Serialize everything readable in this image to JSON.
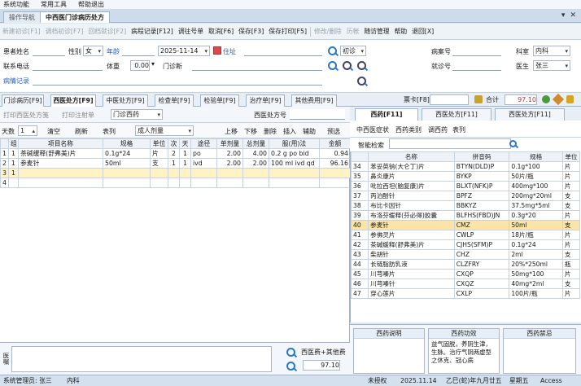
{
  "menu": [
    "系统功能",
    "常用工具",
    "帮助退出"
  ],
  "doc_tabs": [
    "操作导航",
    "中西医门诊病历处方"
  ],
  "window_controls": [
    "▾",
    "✕"
  ],
  "toolbar": [
    {
      "label": "新建初诊[F1]",
      "enabled": false
    },
    {
      "label": "调档初诊[F7]",
      "enabled": false
    },
    {
      "label": "回档就诊[F2]",
      "enabled": false
    },
    {
      "label": "病程记录[F12]",
      "enabled": true
    },
    {
      "label": "调往号单",
      "enabled": true
    },
    {
      "label": "取消[F6]",
      "enabled": true
    },
    {
      "label": "保存[F3]",
      "enabled": true
    },
    {
      "label": "保存打印[F5]",
      "enabled": true
    },
    {
      "label": "修改/删除",
      "enabled": false
    },
    {
      "label": "历帐",
      "enabled": false
    },
    {
      "label": "随访管理",
      "enabled": true
    },
    {
      "label": "帮助",
      "enabled": true
    },
    {
      "label": "退回[X]",
      "enabled": true
    }
  ],
  "form": {
    "name_label": "患者姓名",
    "gender_label": "性别",
    "gender_value": "女",
    "age_label": "年龄",
    "date_value": "2025-11-14",
    "address_label": "住址",
    "visit_type": "初诊",
    "case_no_label": "病案号",
    "dept_label": "科室",
    "dept_value": "内科",
    "phone_label": "联系电话",
    "weight_label": "体重",
    "weight_value": "0.00",
    "diagnosis_label": "门诊断",
    "visit_no_label": "就诊号",
    "doctor_label": "医生",
    "doctor_value": "张三",
    "record_label": "病情记录"
  },
  "left_tabs": [
    "门诊病历[F9]",
    "西医处方[F9]",
    "中医处方[F9]",
    "检查单[F9]",
    "检验单[F9]",
    "治疗单[F9]",
    "其他费用[F9]"
  ],
  "left_tabs_active": 1,
  "rx_bar": {
    "print_rx": "打印西医处方笺",
    "print_inj": "打印注射单",
    "rx_type": "门诊西药",
    "rx_no_label": "西医处方号"
  },
  "top_right": {
    "ticket_label": "票卡[F8]",
    "total_label": "合计",
    "total_value": "97.10"
  },
  "grid_bar": {
    "days_label": "天数",
    "days_value": "1",
    "clear": "清空",
    "refresh": "刷新",
    "rx_table": "表列",
    "dose_type": "成人剂量",
    "up": "上移",
    "down": "下移",
    "delete": "删除",
    "insert": "插入",
    "assist": "辅助",
    "preset": "预选"
  },
  "left_table": {
    "headers": [
      "",
      "组",
      "项目名称",
      "规格",
      "单位",
      "次",
      "天",
      "途径",
      "单剂量",
      "总剂量",
      "服(用)法",
      "金额"
    ],
    "rows": [
      [
        "1",
        "1",
        "茶碱缓释(舒弗美)片",
        "0.1g*24",
        "片",
        "2",
        "1",
        "po",
        "2.00",
        "4.00",
        "0.2 g po bid",
        "0.94"
      ],
      [
        "2",
        "1",
        "参麦针",
        "50ml",
        "支",
        "1",
        "1",
        "ivd",
        "2.00",
        "2.00",
        "100 ml ivd qd",
        "96.16"
      ],
      [
        "3",
        "1",
        "",
        "",
        "",
        "",
        "",
        "",
        "",
        "",
        "",
        ""
      ],
      [
        "4",
        "",
        "",
        "",
        "",
        "",
        "",
        "",
        "",
        "",
        "",
        ""
      ]
    ]
  },
  "left_bottom": {
    "fee_label": "西医费+其他费",
    "fee_value": "97.10",
    "side_label": "医嘱"
  },
  "right_tabs": [
    "西药[F11]",
    "西医处方[F11]",
    "西医处方[F11]"
  ],
  "right_sub": [
    "中西医症状",
    "西药类别",
    "调西药",
    "表列"
  ],
  "right_search": {
    "label": "智能检索"
  },
  "right_table": {
    "headers": [
      "",
      "名称",
      "拼音码",
      "规格",
      "单位"
    ],
    "rows": [
      [
        "34",
        "苯妥英钠(大仑丁)片",
        "BTYN(DLD)P",
        "0.1g*100",
        "片"
      ],
      [
        "35",
        "鼻炎康片",
        "BYKP",
        "50片/瓶",
        "片"
      ],
      [
        "36",
        "吡拉西坦(脑复康)片",
        "BLXT(NFK)P",
        "400mg*100",
        "片"
      ],
      [
        "37",
        "丙泊酚针",
        "BPFZ",
        "200mg*20ml",
        "支"
      ],
      [
        "38",
        "布比卡因针",
        "BBKYZ",
        "37.5mg*5ml",
        "支"
      ],
      [
        "39",
        "布洛芬缓释(芬必得)胶囊",
        "BLFHS(FBD)JN",
        "0.3g*20",
        "片"
      ],
      [
        "40",
        "参麦针",
        "CMZ",
        "50ml",
        "支"
      ],
      [
        "41",
        "参佛灵片",
        "CWLP",
        "18片/瓶",
        "片"
      ],
      [
        "42",
        "茶碱缓释(舒弗美)片",
        "CJHS(SFM)P",
        "0.1g*24",
        "片"
      ],
      [
        "43",
        "柴胡针",
        "CHZ",
        "2ml",
        "支"
      ],
      [
        "44",
        "长链脂肪乳液",
        "CLZFRY",
        "20%*250ml",
        "瓶"
      ],
      [
        "45",
        "川芎嗪片",
        "CXQP",
        "50mg*100",
        "片"
      ],
      [
        "46",
        "川芎嗪针",
        "CXQZ",
        "40mg*2ml",
        "支"
      ],
      [
        "47",
        "穿心莲片",
        "CXLP",
        "100片/瓶",
        "片"
      ]
    ],
    "highlight_index": 6
  },
  "right_desc": {
    "h1": "西药说明",
    "h2": "西药功效",
    "h3": "西药禁忌",
    "effect_text": "益气固脱，养阴生津，生脉。治疗气阴两虚型之休克、冠心病"
  },
  "status": {
    "admin": "系统管理员: 张三",
    "dept": "内科",
    "auth": "未授权",
    "date": "2025.11.14",
    "lunar": "乙巳(蛇)年九月廿五",
    "weekday": "星期五",
    "db": "Access"
  }
}
